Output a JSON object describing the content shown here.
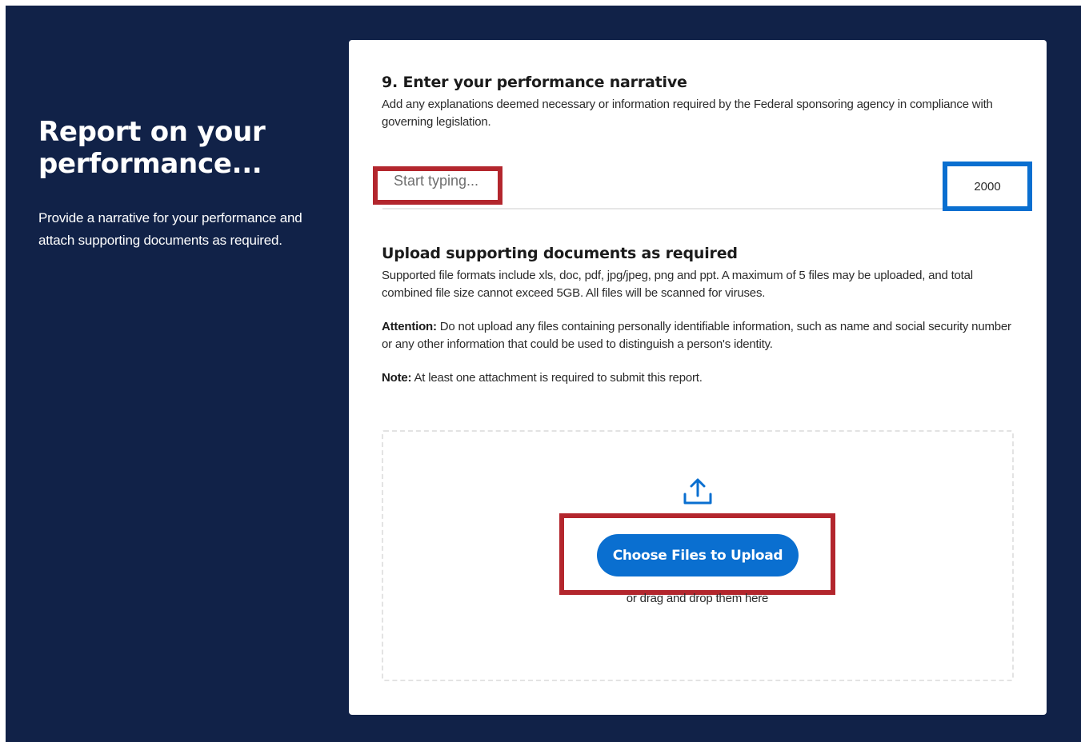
{
  "intro": {
    "title": "Report on your performance...",
    "description": "Provide a narrative for your performance and attach supporting documents as required."
  },
  "narrative": {
    "title": "9. Enter your performance narrative",
    "description": "Add any explanations deemed necessary or information required by the Federal sponsoring agency in compliance with governing legislation.",
    "placeholder": "Start typing...",
    "char_count": "2000"
  },
  "upload": {
    "title": "Upload supporting documents as required",
    "description": "Supported file formats include xls, doc, pdf, jpg/jpeg, png and ppt. A maximum of 5 files may be uploaded, and total combined file size cannot exceed 5GB. All files will be scanned for viruses.",
    "attention_label": "Attention:",
    "attention_text": " Do not upload any files containing personally identifiable information, such as name and social security number or any other information that could be used to distinguish a person's identity.",
    "note_label": "Note:",
    "note_text": " At least one attachment is required to submit this report.",
    "button_label": "Choose Files to Upload",
    "drag_hint": "or drag and drop them here",
    "icon": "upload-icon"
  },
  "colors": {
    "background": "#112248",
    "accent": "#0a6fd0",
    "highlight_red": "#b3262d",
    "highlight_blue": "#0a6fd0"
  }
}
